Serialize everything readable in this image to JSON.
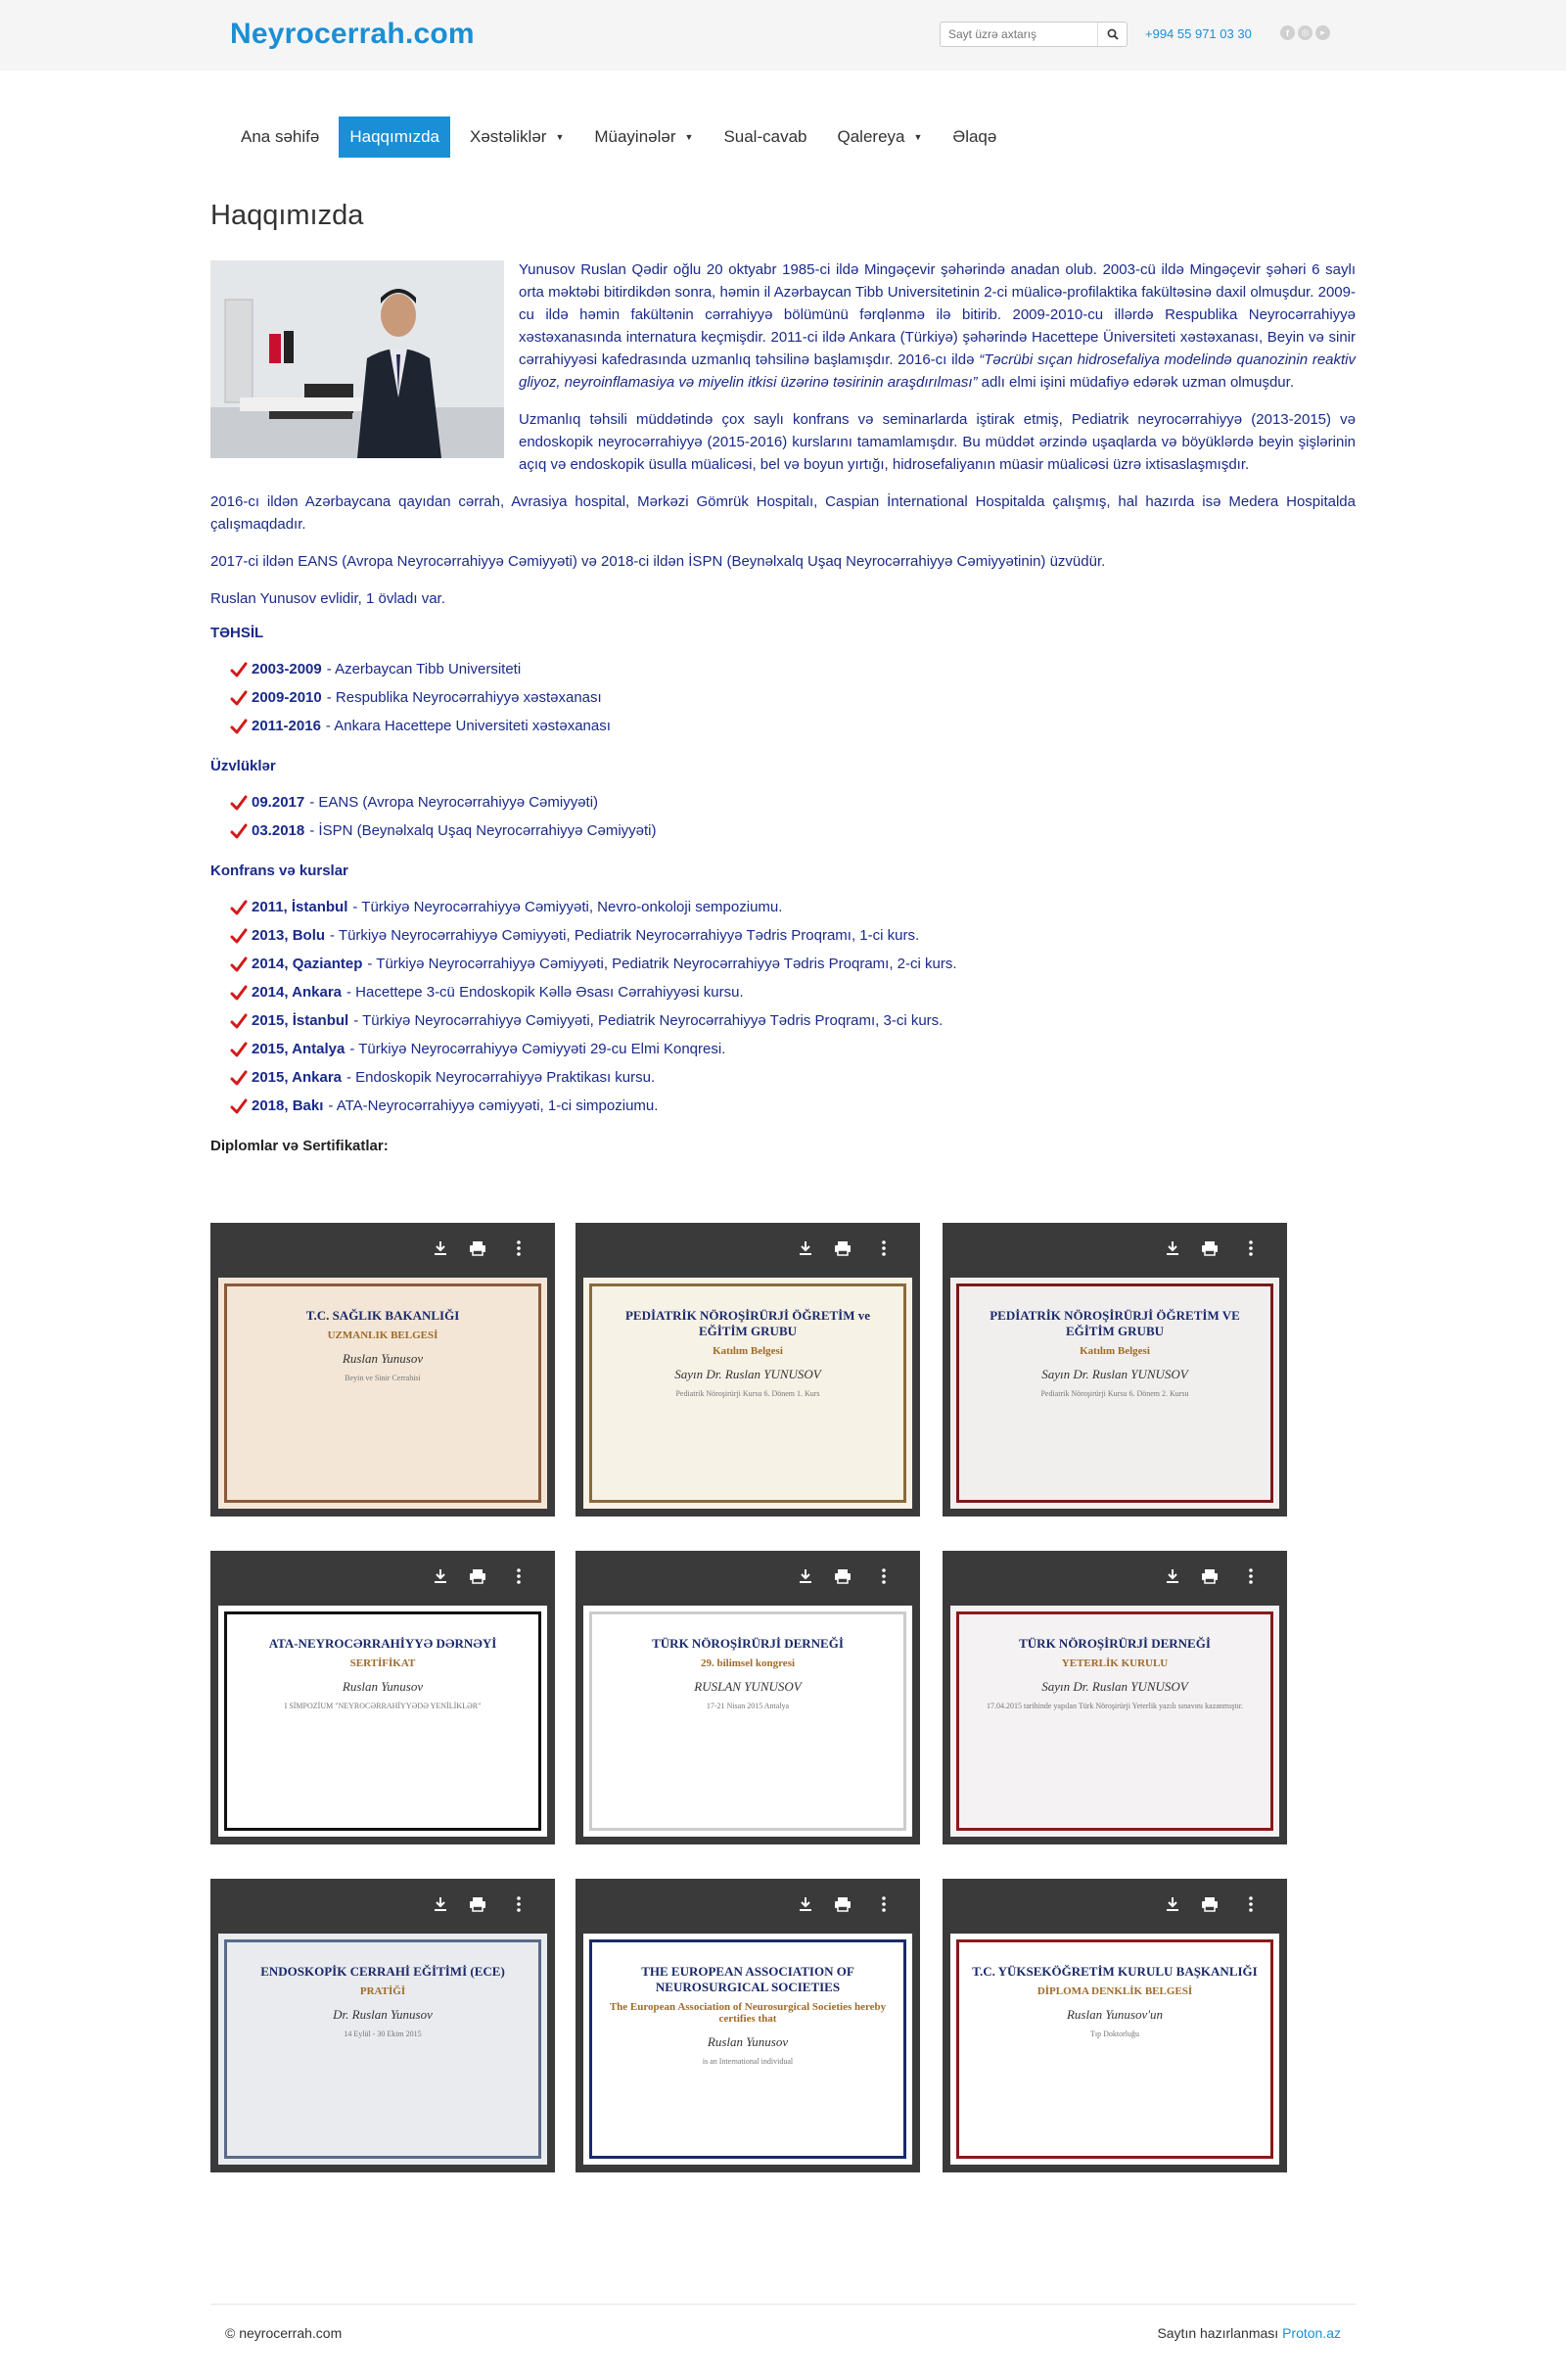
{
  "header": {
    "brand": "Neyrocerrah.com",
    "search_placeholder": "Sayt üzrə axtarış",
    "phone": "+994 55 971 03 30",
    "social": [
      "facebook-icon",
      "instagram-icon",
      "youtube-icon"
    ]
  },
  "nav": {
    "items": [
      {
        "label": "Ana səhifə",
        "active": false,
        "dropdown": false
      },
      {
        "label": "Haqqımızda",
        "active": true,
        "dropdown": false
      },
      {
        "label": "Xəstəliklər",
        "active": false,
        "dropdown": true
      },
      {
        "label": "Müayinələr",
        "active": false,
        "dropdown": true
      },
      {
        "label": "Sual-cavab",
        "active": false,
        "dropdown": false
      },
      {
        "label": "Qalereya",
        "active": false,
        "dropdown": true
      },
      {
        "label": "Əlaqə",
        "active": false,
        "dropdown": false
      }
    ]
  },
  "page": {
    "title": "Haqqımızda",
    "bio_1a": "Yunusov Ruslan Qədir oğlu 20 oktyabr 1985-ci ildə Mingəçevir şəhərində anadan olub. 2003-cü ildə Mingəçevir şəhəri 6 saylı orta məktəbi bitirdikdən sonra, həmin il Azərbaycan Tibb Universitetinin 2-ci müalicə-profilaktika fakültəsinə daxil olmuşdur. 2009-cu ildə həmin fakültənin cərrahiyyə bölümünü fərqlənmə ilə bitirib. 2009-2010-cu illərdə Respublika Neyrocərrahiyyə xəstəxanasında internatura keçmişdir. 2011-ci ildə Ankara (Türkiyə) şəhərində Hacettepe Üniversiteti xəstəxanası, Beyin və sinir cərrahiyyəsi kafedrasında uzmanlıq təhsilinə başlamışdır. 2016-cı ildə",
    "bio_1_italic": "“Təcrübi sıçan hidrosefaliya modelində quanozinin reaktiv gliyoz, neyroinflamasiya və miyelin itkisi üzərinə təsirinin araşdırılması”",
    "bio_1b": "adlı elmi işini müdafiyə edərək uzman olmuşdur.",
    "bio_2": "Uzmanlıq təhsili müddətində çox saylı konfrans və seminarlarda iştirak etmiş,  Pediatrik neyrocərrahiyyə (2013-2015) və endoskopik neyrocərrahiyyə (2015-2016) kurslarını tamamlamışdır. Bu müddət ərzində uşaqlarda və böyüklərdə beyin şişlərinin açıq və endoskopik üsulla müalicəsi, bel və boyun yırtığı, hidrosefaliyanın müasir müalicəsi üzrə ixtisaslaşmışdır.",
    "bio_3": "2016-cı ildən Azərbaycana qayıdan cərrah, Avrasiya hospital, Mərkəzi Gömrük Hospitalı, Caspian İnternational Hospitalda çalışmış, hal hazırda isə  Medera Hospitalda çalışmaqdadır.",
    "bio_4": "2017-ci ildən EANS (Avropa Neyrocərrahiyyə Cəmiyyəti) və 2018-ci ildən İSPN (Beynəlxalq Uşaq Neyrocərrahiyyə Cəmiyyətinin) üzvüdür.",
    "bio_5": "Ruslan Yunusov evlidir, 1 övladı var."
  },
  "education": {
    "heading": "TƏHSİL",
    "items": [
      {
        "year": "2003-2009",
        "text": "- Azerbaycan Tibb Universiteti"
      },
      {
        "year": "2009-2010",
        "text": "- Respublika Neyrocərrahiyyə xəstəxanası"
      },
      {
        "year": "2011-2016",
        "text": "- Ankara Hacettepe Universiteti xəstəxanası"
      }
    ]
  },
  "memberships": {
    "heading": "Üzvlüklər",
    "items": [
      {
        "year": "09.2017",
        "text": "- EANS (Avropa Neyrocərrahiyyə Cəmiyyəti)"
      },
      {
        "year": "03.2018",
        "text": "- İSPN (Beynəlxalq Uşaq Neyrocərrahiyyə Cəmiyyəti)"
      }
    ]
  },
  "conferences": {
    "heading": "Konfrans və kurslar",
    "items": [
      {
        "year": "2011, İstanbul",
        "text": "- Türkiyə Neyrocərrahiyyə Cəmiyyəti, Nevro-onkoloji sempoziumu."
      },
      {
        "year": "2013, Bolu",
        "text": "- Türkiyə Neyrocərrahiyyə Cəmiyyəti, Pediatrik Neyrocərrahiyyə Tədris Proqramı, 1-ci kurs."
      },
      {
        "year": "2014, Qaziantep",
        "text": "- Türkiyə Neyrocərrahiyyə Cəmiyyəti, Pediatrik Neyrocərrahiyyə Tədris Proqramı, 2-ci kurs."
      },
      {
        "year": "2014, Ankara",
        "text": "- Hacettepe 3-cü Endoskopik Kəllə Əsası Cərrahiyyəsi kursu."
      },
      {
        "year": "2015, İstanbul",
        "text": "- Türkiyə Neyrocərrahiyyə Cəmiyyəti, Pediatrik Neyrocərrahiyyə Tədris Proqramı, 3-ci kurs."
      },
      {
        "year": "2015, Antalya",
        "text": "- Türkiyə Neyrocərrahiyyə Cəmiyyəti 29-cu Elmi Konqresi."
      },
      {
        "year": "2015, Ankara",
        "text": "- Endoskopik Neyrocərrahiyyə Praktikası kursu."
      },
      {
        "year": "2018, Bakı",
        "text": "- ATA-Neyrocərrahiyyə cəmiyyəti, 1-ci simpoziumu."
      }
    ]
  },
  "diplomas": {
    "heading": "Diplomlar və Sertifikatlar:",
    "cards": [
      {
        "title": "T.C. SAĞLIK BAKANLIĞI",
        "sub": "UZMANLIK BELGESİ",
        "name": "Ruslan Yunusov",
        "foot": "Beyin ve Sinir Cerrahisi",
        "theme": "#8a5a3c",
        "bg": "#f3e6d6"
      },
      {
        "title": "PEDİATRİK NÖROŞİRÜRJİ ÖĞRETİM ve EĞİTİM GRUBU",
        "sub": "Katılım Belgesi",
        "name": "Sayın Dr. Ruslan YUNUSOV",
        "foot": "Pediatrik Nöroşirürji Kursu 6. Dönem 1. Kurs",
        "theme": "#8a6a3c",
        "bg": "#f7f2e6"
      },
      {
        "title": "PEDİATRİK NÖROŞİRÜRJİ ÖĞRETİM VE EĞİTİM GRUBU",
        "sub": "Katılım Belgesi",
        "name": "Sayın Dr. Ruslan YUNUSOV",
        "foot": "Pediatrik Nöroşirürji Kursu 6. Dönem 2. Kursu",
        "theme": "#7a1a1a",
        "bg": "#f1efee"
      },
      {
        "title": "ATA-NEYROCƏRRAHİYYƏ DƏRNƏYİ",
        "sub": "SERTİFİKAT",
        "name": "Ruslan Yunusov",
        "foot": "I SİMPOZİUM \"NEYROCƏRRAHİYYƏDƏ YENİLİKLƏR\"",
        "theme": "#111111",
        "bg": "#ffffff"
      },
      {
        "title": "TÜRK NÖROŞİRÜRJİ DERNEĞİ",
        "sub": "29. bilimsel kongresi",
        "name": "RUSLAN YUNUSOV",
        "foot": "17-21 Nisan 2015 Antalya",
        "theme": "#cccccc",
        "bg": "#ffffff"
      },
      {
        "title": "TÜRK NÖROŞİRÜRJİ DERNEĞİ",
        "sub": "YETERLİK KURULU",
        "name": "Sayın Dr. Ruslan YUNUSOV",
        "foot": "17.04.2015 tarihinde yapılan Türk Nöroşirürji Yeterlik yazılı sınavını kazanmıştır.",
        "theme": "#8a1a1a",
        "bg": "#f4f2f2"
      },
      {
        "title": "ENDOSKOPİK CERRAHİ EĞİTİMİ (ECE)",
        "sub": "PRATİĞİ",
        "name": "Dr. Ruslan Yunusov",
        "foot": "14 Eylül - 30 Ekim 2015",
        "theme": "#5a6a8a",
        "bg": "#e9ebee"
      },
      {
        "title": "THE EUROPEAN ASSOCIATION OF NEUROSURGICAL SOCIETIES",
        "sub": "The European Association of Neurosurgical Societies hereby certifies that",
        "name": "Ruslan Yunusov",
        "foot": "is an International individual",
        "theme": "#1a2a6a",
        "bg": "#ffffff"
      },
      {
        "title": "T.C. YÜKSEKÖĞRETİM KURULU BAŞKANLIĞI",
        "sub": "DİPLOMA DENKLİK BELGESİ",
        "name": "Ruslan Yunusov'un",
        "foot": "Tıp Doktorluğu",
        "theme": "#8a1a1a",
        "bg": "#ffffff"
      }
    ]
  },
  "footer": {
    "copyright": "© neyrocerrah.com",
    "made_by": "Saytın hazırlanması",
    "made_link": "Proton.az"
  }
}
